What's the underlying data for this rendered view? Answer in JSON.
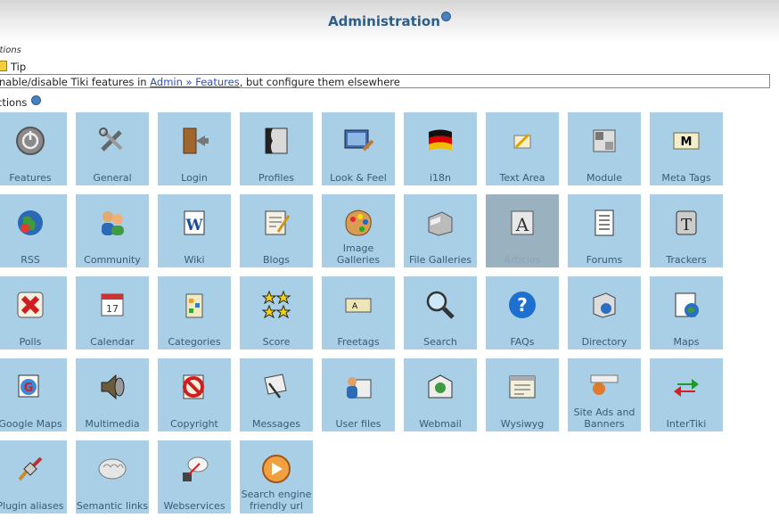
{
  "header": {
    "title": "Administration"
  },
  "breadcrumb": "ctions",
  "tip": {
    "title": "Tip",
    "text_prefix": "nable/disable Tiki features in ",
    "link": "Admin » Features",
    "text_suffix": ", but configure them elsewhere"
  },
  "sections_label": "ctions",
  "tiles": [
    {
      "label": "Features",
      "icon": "power-icon"
    },
    {
      "label": "General",
      "icon": "tools-icon"
    },
    {
      "label": "Login",
      "icon": "door-icon"
    },
    {
      "label": "Profiles",
      "icon": "profile-icon"
    },
    {
      "label": "Look & Feel",
      "icon": "paint-picture-icon"
    },
    {
      "label": "i18n",
      "icon": "flag-icon"
    },
    {
      "label": "Text Area",
      "icon": "pencil-icon"
    },
    {
      "label": "Module",
      "icon": "module-icon"
    },
    {
      "label": "Meta Tags",
      "icon": "tag-icon"
    },
    {
      "label": "RSS",
      "icon": "globe-icon"
    },
    {
      "label": "Community",
      "icon": "people-icon"
    },
    {
      "label": "Wiki",
      "icon": "wiki-icon"
    },
    {
      "label": "Blogs",
      "icon": "blog-icon"
    },
    {
      "label": "Image Galleries",
      "icon": "palette-icon"
    },
    {
      "label": "File Galleries",
      "icon": "file-cabinet-icon"
    },
    {
      "label": "Articles",
      "icon": "article-icon",
      "disabled": true
    },
    {
      "label": "Forums",
      "icon": "forum-icon"
    },
    {
      "label": "Trackers",
      "icon": "tracker-icon"
    },
    {
      "label": "Polls",
      "icon": "x-icon"
    },
    {
      "label": "Calendar",
      "icon": "calendar-icon"
    },
    {
      "label": "Categories",
      "icon": "categories-icon"
    },
    {
      "label": "Score",
      "icon": "stars-icon"
    },
    {
      "label": "Freetags",
      "icon": "freetag-icon"
    },
    {
      "label": "Search",
      "icon": "magnifier-icon"
    },
    {
      "label": "FAQs",
      "icon": "question-icon"
    },
    {
      "label": "Directory",
      "icon": "directory-icon"
    },
    {
      "label": "Maps",
      "icon": "map-icon"
    },
    {
      "label": "Google Maps",
      "icon": "google-maps-icon"
    },
    {
      "label": "Multimedia",
      "icon": "speaker-icon"
    },
    {
      "label": "Copyright",
      "icon": "no-copy-icon"
    },
    {
      "label": "Messages",
      "icon": "messages-icon"
    },
    {
      "label": "User files",
      "icon": "user-files-icon"
    },
    {
      "label": "Webmail",
      "icon": "webmail-icon"
    },
    {
      "label": "Wysiwyg",
      "icon": "wysiwyg-icon"
    },
    {
      "label": "Site Ads and Banners",
      "icon": "banner-icon"
    },
    {
      "label": "InterTiki",
      "icon": "arrows-icon"
    },
    {
      "label": "Plugin aliases",
      "icon": "plug-icon"
    },
    {
      "label": "Semantic links",
      "icon": "brain-icon"
    },
    {
      "label": "Webservices",
      "icon": "webservice-icon"
    },
    {
      "label": "Search engine friendly url",
      "icon": "sefurl-icon"
    }
  ]
}
